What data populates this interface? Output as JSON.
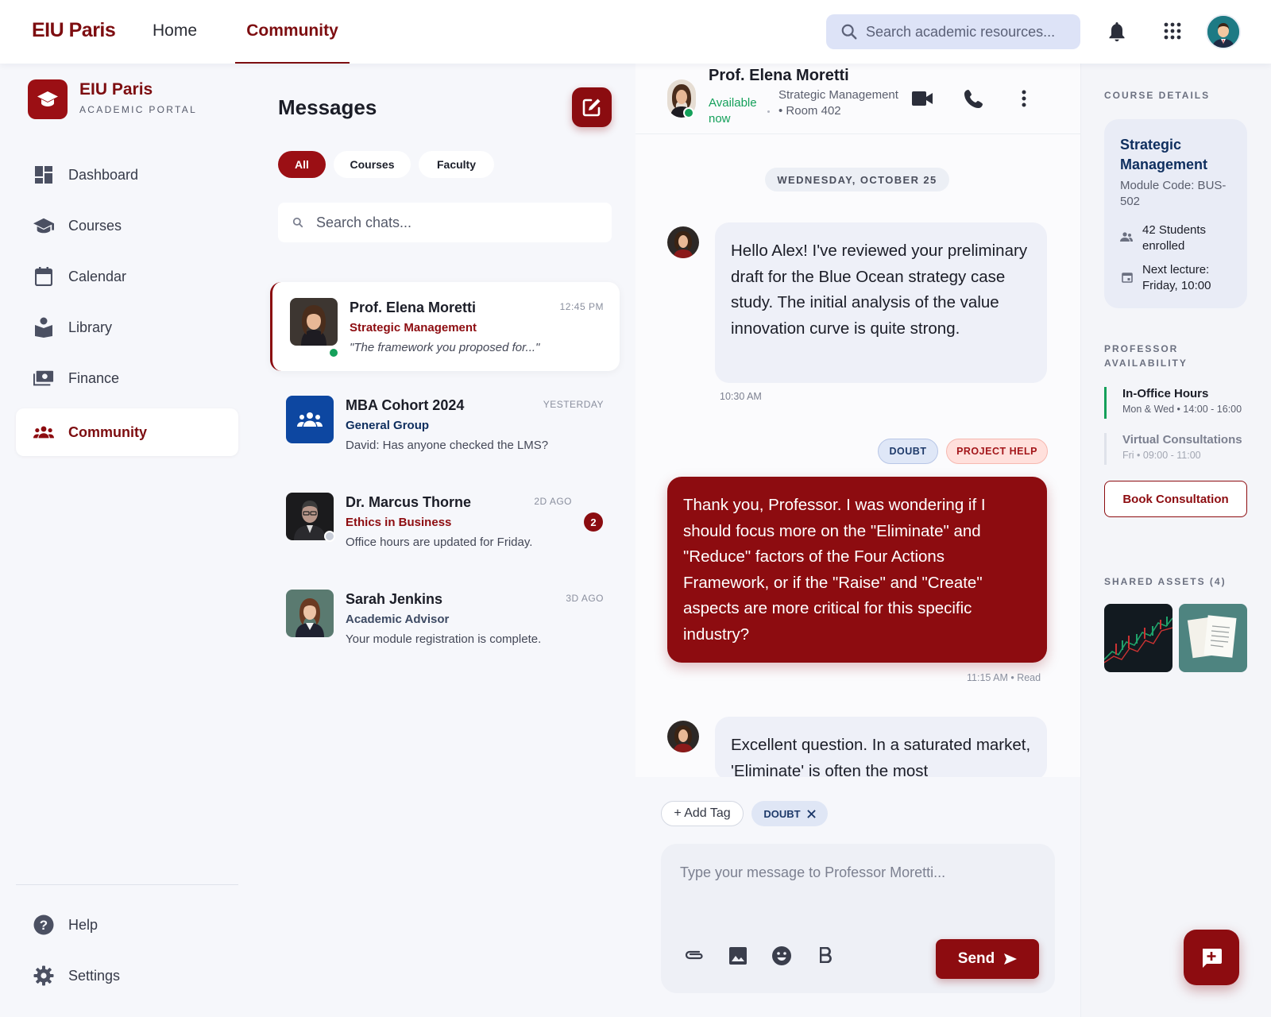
{
  "topbar": {
    "brand": "EIU Paris",
    "nav": {
      "home": "Home",
      "community": "Community"
    },
    "search_placeholder": "Search academic resources..."
  },
  "sidebar": {
    "brand": "EIU Paris",
    "subtitle": "ACADEMIC PORTAL",
    "items": [
      {
        "label": "Dashboard",
        "icon": "dashboard-icon"
      },
      {
        "label": "Courses",
        "icon": "school-icon"
      },
      {
        "label": "Calendar",
        "icon": "calendar-icon"
      },
      {
        "label": "Library",
        "icon": "library-icon"
      },
      {
        "label": "Finance",
        "icon": "finance-icon"
      },
      {
        "label": "Community",
        "icon": "community-icon",
        "active": true
      }
    ],
    "footer": [
      {
        "label": "Help",
        "icon": "help-icon"
      },
      {
        "label": "Settings",
        "icon": "gear-icon"
      }
    ]
  },
  "messages": {
    "title": "Messages",
    "filters": {
      "all": "All",
      "courses": "Courses",
      "faculty": "Faculty"
    },
    "search_placeholder": "Search chats...",
    "conversations": [
      {
        "name": "Prof. Elena Moretti",
        "subtitle": "Strategic Management",
        "preview": "\"The framework you proposed for...\"",
        "time": "12:45 PM",
        "online": true
      },
      {
        "name": "MBA Cohort 2024",
        "subtitle": "General Group",
        "preview": "David: Has anyone checked the LMS?",
        "time": "YESTERDAY"
      },
      {
        "name": "Dr. Marcus Thorne",
        "subtitle": "Ethics in Business",
        "preview": "Office hours are updated for Friday.",
        "time": "2D AGO",
        "unread": "2"
      },
      {
        "name": "Sarah Jenkins",
        "subtitle": "Academic Advisor",
        "preview": "Your module registration is complete.",
        "time": "3D AGO"
      }
    ]
  },
  "chat": {
    "name": "Prof. Elena Moretti",
    "status": "Available now",
    "course": "Strategic Management • Room 402",
    "date": "WEDNESDAY, OCTOBER 25",
    "msg1": "Hello Alex! I've reviewed your preliminary draft for the Blue Ocean strategy case study. The initial analysis of the value innovation curve is quite strong.",
    "msg1_time": "10:30 AM",
    "tags": {
      "doubt": "DOUBT",
      "project": "PROJECT HELP"
    },
    "msg2": "Thank you, Professor. I was wondering if I should focus more on the \"Eliminate\" and \"Reduce\" factors of the Four Actions Framework, or if the \"Raise\" and \"Create\" aspects are more critical for this specific industry?",
    "msg2_time": "11:15 AM • Read",
    "msg3": "Excellent question. In a saturated market, 'Eliminate' is often the most",
    "add_tag": "+ Add Tag",
    "active_tag": "DOUBT",
    "input_placeholder": "Type your message to Professor Moretti...",
    "send": "Send"
  },
  "right": {
    "course_details_heading": "COURSE DETAILS",
    "course_title": "Strategic Management",
    "module_code": "Module Code: BUS-502",
    "students": "42 Students enrolled",
    "next_lecture": "Next lecture: Friday, 10:00",
    "availability_heading": "PROFESSOR AVAILABILITY",
    "availability": [
      {
        "title": "In-Office Hours",
        "time": "Mon & Wed • 14:00 - 16:00",
        "active": true
      },
      {
        "title": "Virtual Consultations",
        "time": "Fri • 09:00 - 11:00",
        "active": false
      }
    ],
    "book_button": "Book Consultation",
    "assets_heading": "SHARED ASSETS (4)"
  },
  "colors": {
    "brand": "#8d0c10",
    "online": "#14a05a",
    "navy": "#0e2e5e"
  }
}
